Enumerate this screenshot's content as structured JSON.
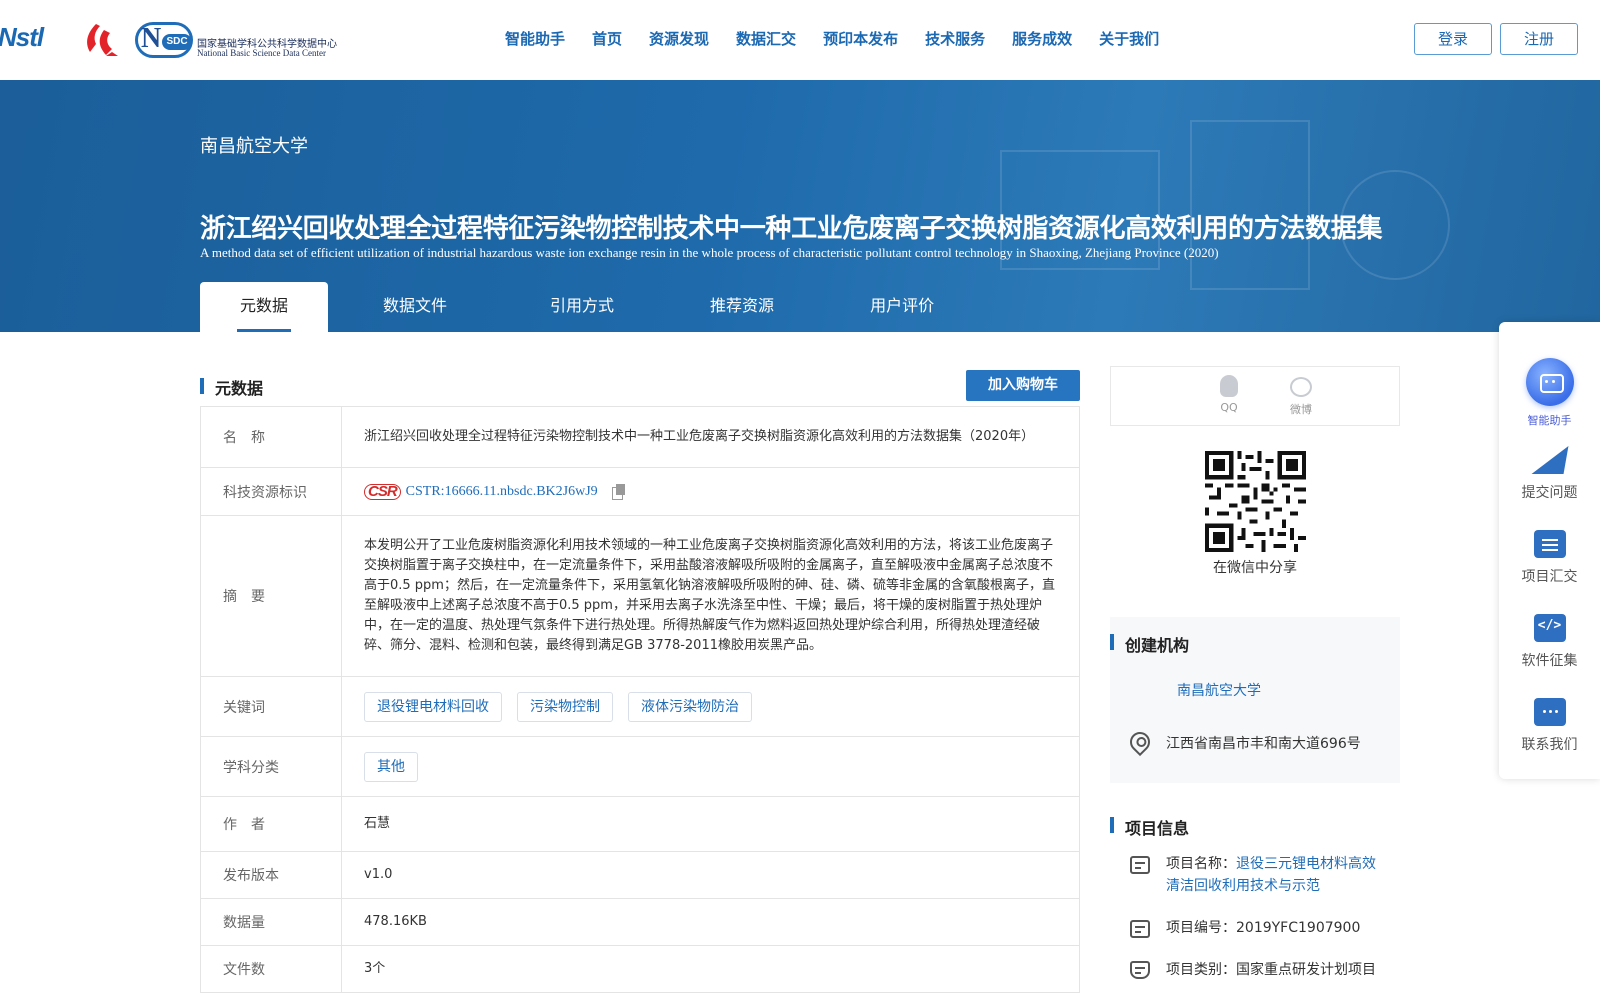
{
  "header": {
    "logo_nstl": "Nstl",
    "logo_nsdc_mark": "N",
    "logo_nsdc_sdc": "SDC",
    "logo_nsdc_cn": "国家基础学科公共科学数据中心",
    "logo_nsdc_en": "National Basic Science Data Center",
    "nav": [
      "智能助手",
      "首页",
      "资源发现",
      "数据汇交",
      "预印本发布",
      "技术服务",
      "服务成效",
      "关于我们"
    ],
    "login": "登录",
    "register": "注册"
  },
  "banner": {
    "institution": "南昌航空大学",
    "title_cn": "浙江绍兴回收处理全过程特征污染物控制技术中一种工业危废离子交换树脂资源化高效利用的方法数据集",
    "title_en": "A method data set of efficient utilization of industrial hazardous waste ion exchange resin in the whole process of characteristic pollutant control technology in Shaoxing, Zhejiang Province (2020)",
    "tabs": [
      "元数据",
      "数据文件",
      "引用方式",
      "推荐资源",
      "用户评价"
    ]
  },
  "metadata": {
    "section_title": "元数据",
    "cart_button": "加入购物车",
    "labels": {
      "name": "名　称",
      "cstr": "科技资源标识",
      "abstract": "摘　要",
      "keywords": "关键词",
      "subject": "学科分类",
      "author": "作　者",
      "version": "发布版本",
      "size": "数据量",
      "files": "文件数"
    },
    "name": "浙江绍兴回收处理全过程特征污染物控制技术中一种工业危废离子交换树脂资源化高效利用的方法数据集（2020年）",
    "cstr_logo": "CSR",
    "cstr": "CSTR:16666.11.nbsdc.BK2J6wJ9",
    "abstract": "本发明公开了工业危废树脂资源化利用技术领域的一种工业危废离子交换树脂资源化高效利用的方法，将该工业危废离子交换树脂置于离子交换柱中，在一定流量条件下，采用盐酸溶液解吸所吸附的金属离子，直至解吸液中金属离子总浓度不高于0.5 ppm；然后，在一定流量条件下，采用氢氧化钠溶液解吸所吸附的砷、硅、磷、硫等非金属的含氧酸根离子，直至解吸液中上述离子总浓度不高于0.5 ppm，并采用去离子水洗涤至中性、干燥；最后，将干燥的废树脂置于热处理炉中，在一定的温度、热处理气氛条件下进行热处理。所得热解废气作为燃料返回热处理炉综合利用，所得热处理渣经破碎、筛分、混料、检测和包装，最终得到满足GB 3778-2011橡胶用炭黑产品。",
    "keywords": [
      "退役锂电材料回收",
      "污染物控制",
      "液体污染物防治"
    ],
    "subjects": [
      "其他"
    ],
    "author": "石慧",
    "version": "v1.0",
    "size": "478.16KB",
    "files": "3个"
  },
  "sidebar": {
    "share": {
      "qq": "QQ",
      "weibo": "微博"
    },
    "qr_caption": "在微信中分享",
    "org": {
      "title": "创建机构",
      "name": "南昌航空大学",
      "address": "江西省南昌市丰和南大道696号"
    },
    "project": {
      "title": "项目信息",
      "name_label": "项目名称：",
      "name_value": "退役三元锂电材料高效清洁回收利用技术与示范",
      "number_label": "项目编号：",
      "number_value": "2019YFC1907900",
      "type_label": "项目类别：",
      "type_value": "国家重点研发计划项目"
    }
  },
  "float_panel": {
    "assistant": "智能助手",
    "submit": "提交问题",
    "project": "项目汇交",
    "software": "软件征集",
    "contact": "联系我们",
    "software_glyph": "</>"
  }
}
